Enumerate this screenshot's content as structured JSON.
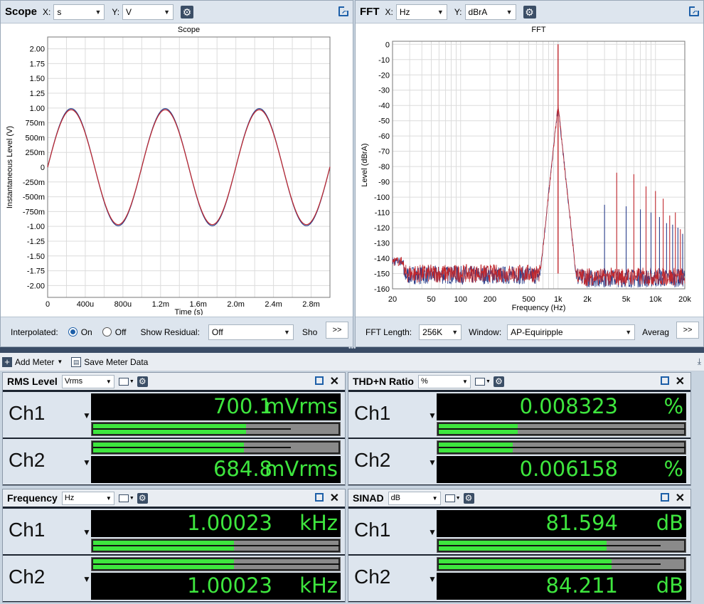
{
  "scope": {
    "title": "Scope",
    "x_label": "X:",
    "x_unit": "s",
    "y_label": "Y:",
    "y_unit": "V",
    "footer": {
      "interpolated_label": "Interpolated:",
      "on_label": "On",
      "off_label": "Off",
      "show_residual_label": "Show Residual:",
      "residual_value": "Off",
      "truncated_label": "Sho",
      "more_label": ">>"
    }
  },
  "fft": {
    "title": "FFT",
    "x_label": "X:",
    "x_unit": "Hz",
    "y_label": "Y:",
    "y_unit": "dBrA",
    "footer": {
      "length_label": "FFT Length:",
      "length_value": "256K",
      "window_label": "Window:",
      "window_value": "AP-Equiripple",
      "truncated_label": "Averag",
      "more_label": ">>"
    }
  },
  "toolbar": {
    "add_meter": "Add Meter",
    "save_meter_data": "Save Meter Data"
  },
  "colors": {
    "ch1": "#2b3f8c",
    "ch2": "#c0282e",
    "lcd_text": "#3ee63e"
  },
  "meters": [
    {
      "title": "RMS Level",
      "unit_select": "Vrms",
      "ch1": {
        "label": "Ch1",
        "value": "700.1",
        "unit": "mVrms",
        "fill": 0.62,
        "peak": 0.8
      },
      "ch2": {
        "label": "Ch2",
        "value": "684.8",
        "unit": "mVrms",
        "fill": 0.61,
        "peak": 0.8
      }
    },
    {
      "title": "THD+N Ratio",
      "unit_select": "%",
      "ch1": {
        "label": "Ch1",
        "value": "0.008323",
        "unit": "%",
        "fill": 0.32,
        "peak": 1.0
      },
      "ch2": {
        "label": "Ch2",
        "value": "0.006158",
        "unit": "%",
        "fill": 0.3,
        "peak": 1.0
      }
    },
    {
      "title": "Frequency",
      "unit_select": "Hz",
      "ch1": {
        "label": "Ch1",
        "value": "1.00023",
        "unit": "kHz",
        "fill": 0.57,
        "peak": 1.0
      },
      "ch2": {
        "label": "Ch2",
        "value": "1.00023",
        "unit": "kHz",
        "fill": 0.57,
        "peak": 1.0
      }
    },
    {
      "title": "SINAD",
      "unit_select": "dB",
      "ch1": {
        "label": "Ch1",
        "value": "81.594",
        "unit": "dB",
        "fill": 0.68,
        "peak": 0.9
      },
      "ch2": {
        "label": "Ch2",
        "value": "84.211",
        "unit": "dB",
        "fill": 0.7,
        "peak": 0.9
      }
    }
  ],
  "chart_data": [
    {
      "type": "line",
      "title": "Scope",
      "xlabel": "Time (s)",
      "ylabel": "Instantaneous Level (V)",
      "xlim": [
        0,
        0.003
      ],
      "ylim": [
        -2.2,
        2.2
      ],
      "x_ticks": [
        "0",
        "400u",
        "800u",
        "1.2m",
        "1.6m",
        "2.0m",
        "2.4m",
        "2.8m"
      ],
      "y_ticks": [
        "2.00",
        "1.75",
        "1.50",
        "1.25",
        "1.00",
        "750m",
        "500m",
        "250m",
        "0",
        "-250m",
        "-500m",
        "-750m",
        "-1.00",
        "-1.25",
        "-1.50",
        "-1.75",
        "-2.00"
      ],
      "grid": true,
      "series": [
        {
          "amplitude": 0.99,
          "frequency": 1000.23,
          "color": "#2b3f8c"
        },
        {
          "amplitude": 0.97,
          "frequency": 1000.23,
          "color": "#c0282e"
        }
      ]
    },
    {
      "type": "line",
      "title": "FFT",
      "xlabel": "Frequency (Hz)",
      "ylabel": "Level (dBrA)",
      "xscale": "log",
      "xlim": [
        20,
        20000
      ],
      "ylim": [
        -160,
        2
      ],
      "x_ticks": [
        "20",
        "50",
        "100",
        "200",
        "500",
        "1k",
        "2k",
        "5k",
        "10k",
        "20k"
      ],
      "y_ticks": [
        "0",
        "-10",
        "-20",
        "-30",
        "-40",
        "-50",
        "-60",
        "-70",
        "-80",
        "-90",
        "-100",
        "-110",
        "-120",
        "-130",
        "-140",
        "-150",
        "-160"
      ],
      "grid": true,
      "noise_floor": -150,
      "fundamental": {
        "frequency": 1000,
        "level": 0
      },
      "harmonics": [
        {
          "frequency": 2000,
          "level": -158
        },
        {
          "frequency": 3000,
          "level": -105
        },
        {
          "frequency": 4000,
          "level": -84
        },
        {
          "frequency": 5000,
          "level": -106
        },
        {
          "frequency": 6000,
          "level": -85
        },
        {
          "frequency": 7000,
          "level": -108
        },
        {
          "frequency": 8000,
          "level": -93
        },
        {
          "frequency": 9000,
          "level": -110
        },
        {
          "frequency": 10000,
          "level": -96
        },
        {
          "frequency": 11000,
          "level": -113
        },
        {
          "frequency": 12000,
          "level": -101
        },
        {
          "frequency": 13000,
          "level": -117
        },
        {
          "frequency": 14000,
          "level": -112
        },
        {
          "frequency": 15000,
          "level": -118
        },
        {
          "frequency": 16000,
          "level": -110
        },
        {
          "frequency": 17000,
          "level": -120
        },
        {
          "frequency": 18000,
          "level": -121
        },
        {
          "frequency": 19000,
          "level": -124
        }
      ]
    }
  ]
}
